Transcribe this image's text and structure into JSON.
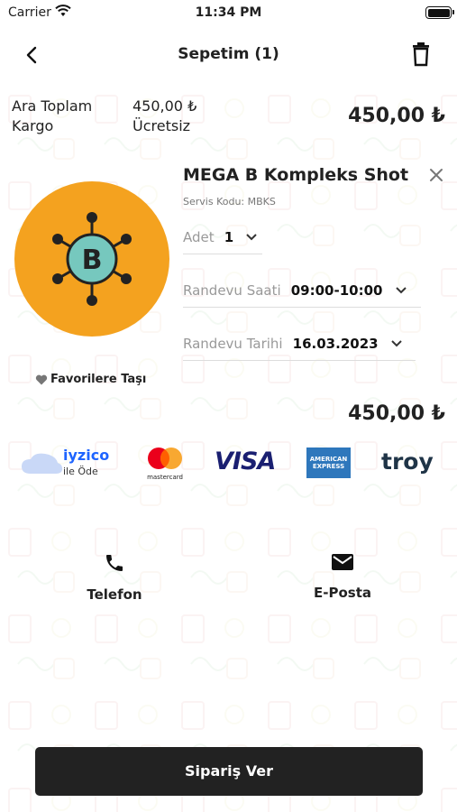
{
  "status_bar": {
    "carrier": "Carrier",
    "time": "11:34 PM"
  },
  "nav": {
    "title": "Sepetim (1)"
  },
  "summary": {
    "subtotal_label": "Ara Toplam",
    "subtotal_value": "450,00 ₺",
    "shipping_label": "Kargo",
    "shipping_value": "Ücretsiz",
    "total": "450,00 ₺"
  },
  "product": {
    "name": "MEGA B Kompleks Shot",
    "service_code": "Servis Kodu: MBKS",
    "image_letter": "B",
    "quantity_label": "Adet",
    "quantity_value": "1",
    "time_label": "Randevu Saati",
    "time_value": "09:00-10:00",
    "date_label": "Randevu Tarihi",
    "date_value": "16.03.2023",
    "favorite_label": "Favorilere Taşı",
    "price": "450,00 ₺"
  },
  "payment": {
    "iyzico_brand": "iyzico",
    "iyzico_sub": "ile Öde",
    "mastercard_text": "mastercard",
    "visa": "VISA",
    "amex_line1": "AMERICAN",
    "amex_line2": "EXPRESS",
    "troy": "troy"
  },
  "contact": {
    "phone_label": "Telefon",
    "email_label": "E-Posta"
  },
  "order_button": "Sipariş Ver",
  "colors": {
    "accent_orange": "#F4A21F",
    "icon_teal": "#76C8BE",
    "button_dark": "#222222"
  }
}
